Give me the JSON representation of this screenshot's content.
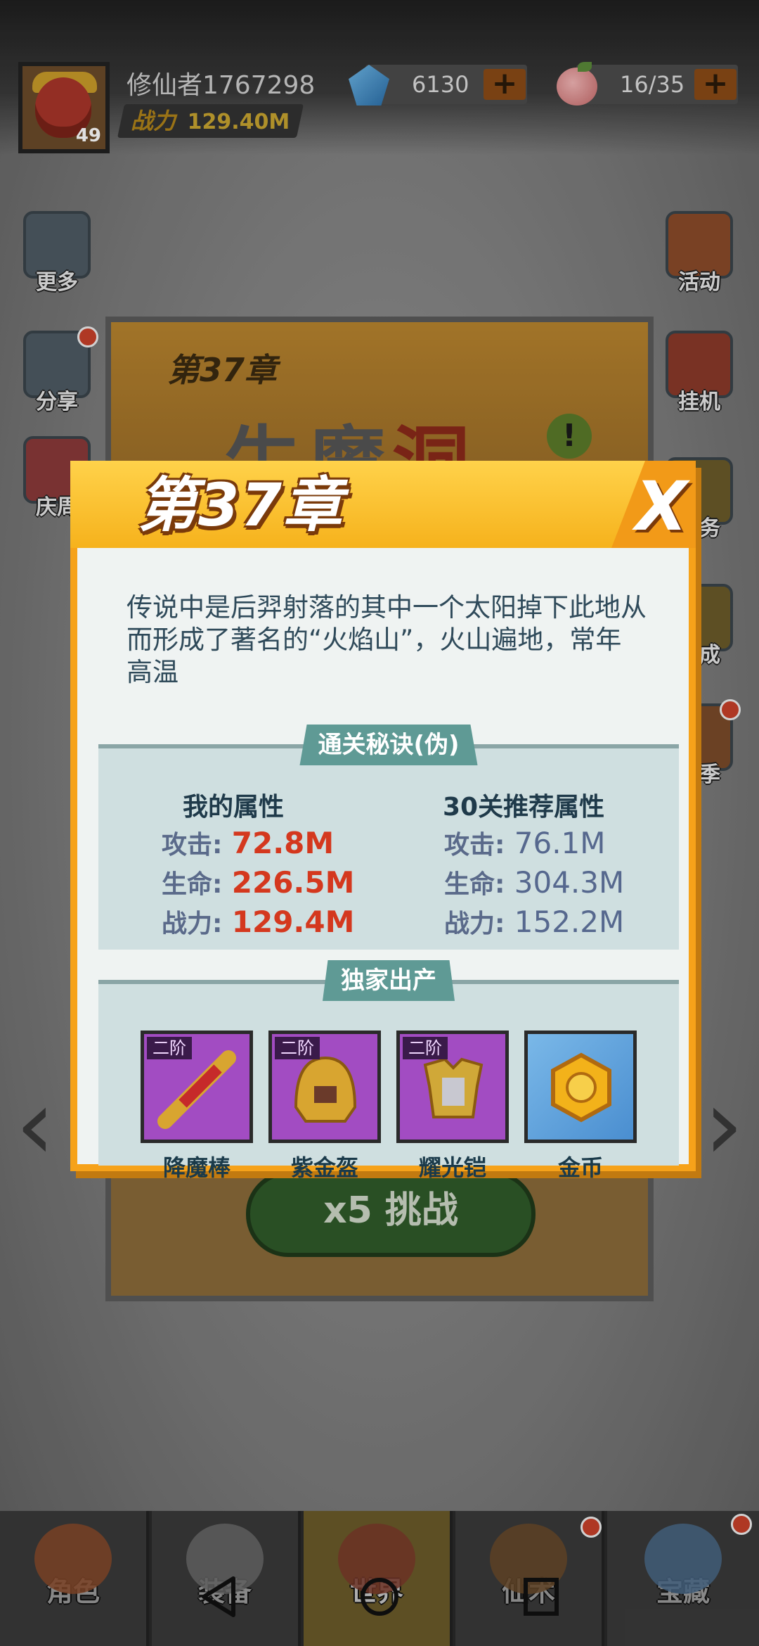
{
  "player": {
    "name": "修仙者1767298",
    "level": "49",
    "power_label": "战力",
    "power_value": "129.40M"
  },
  "resources": {
    "gems": "6130",
    "stamina": "16/35"
  },
  "side_left": [
    {
      "label": "更多"
    },
    {
      "label": "分享"
    },
    {
      "label": "庆周"
    }
  ],
  "side_right": [
    {
      "label": "活动"
    },
    {
      "label": "挂机"
    },
    {
      "label": "任务"
    },
    {
      "label": "达成"
    },
    {
      "label": "赛季"
    }
  ],
  "chapter_card": {
    "small_title": "第37章",
    "title_main": "生魔",
    "title_highlight": "洞",
    "challenge_cost": "x5",
    "challenge_label": "挑战"
  },
  "modal": {
    "title": "第37章",
    "close": "X",
    "description": "传说中是后羿射落的其中一个太阳掉下此地从而形成了著名的“火焰山”，火山遍地，常年高温",
    "tips": {
      "tab": "通关秘诀(伪)",
      "mine": {
        "header": "我的属性",
        "attack_label": "攻击:",
        "attack": "72.8M",
        "hp_label": "生命:",
        "hp": "226.5M",
        "power_label": "战力:",
        "power": "129.4M"
      },
      "recommended": {
        "header": "30关推荐属性",
        "attack_label": "攻击:",
        "attack": "76.1M",
        "hp_label": "生命:",
        "hp": "304.3M",
        "power_label": "战力:",
        "power": "152.2M"
      }
    },
    "drops": {
      "tab": "独家出产",
      "items": [
        {
          "tier": "二阶",
          "name": "降魔棒"
        },
        {
          "tier": "二阶",
          "name": "紫金盔"
        },
        {
          "tier": "二阶",
          "name": "耀光铠"
        },
        {
          "tier": "",
          "name": "金币"
        }
      ]
    }
  },
  "bottom_nav": [
    {
      "label": "角色"
    },
    {
      "label": "装备"
    },
    {
      "label": "世界"
    },
    {
      "label": "仙术"
    },
    {
      "label": "宝藏"
    }
  ]
}
